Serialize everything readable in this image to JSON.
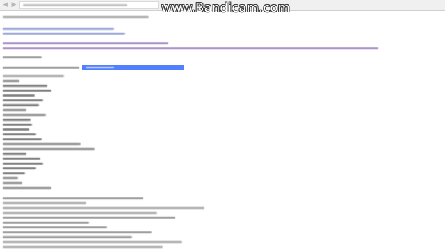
{
  "watermark": {
    "text": "www.Bandicam.com"
  },
  "browser": {
    "back_glyph": "◀",
    "forward_glyph": "▶"
  },
  "editor": {
    "selection_color": "#3f72ff"
  }
}
